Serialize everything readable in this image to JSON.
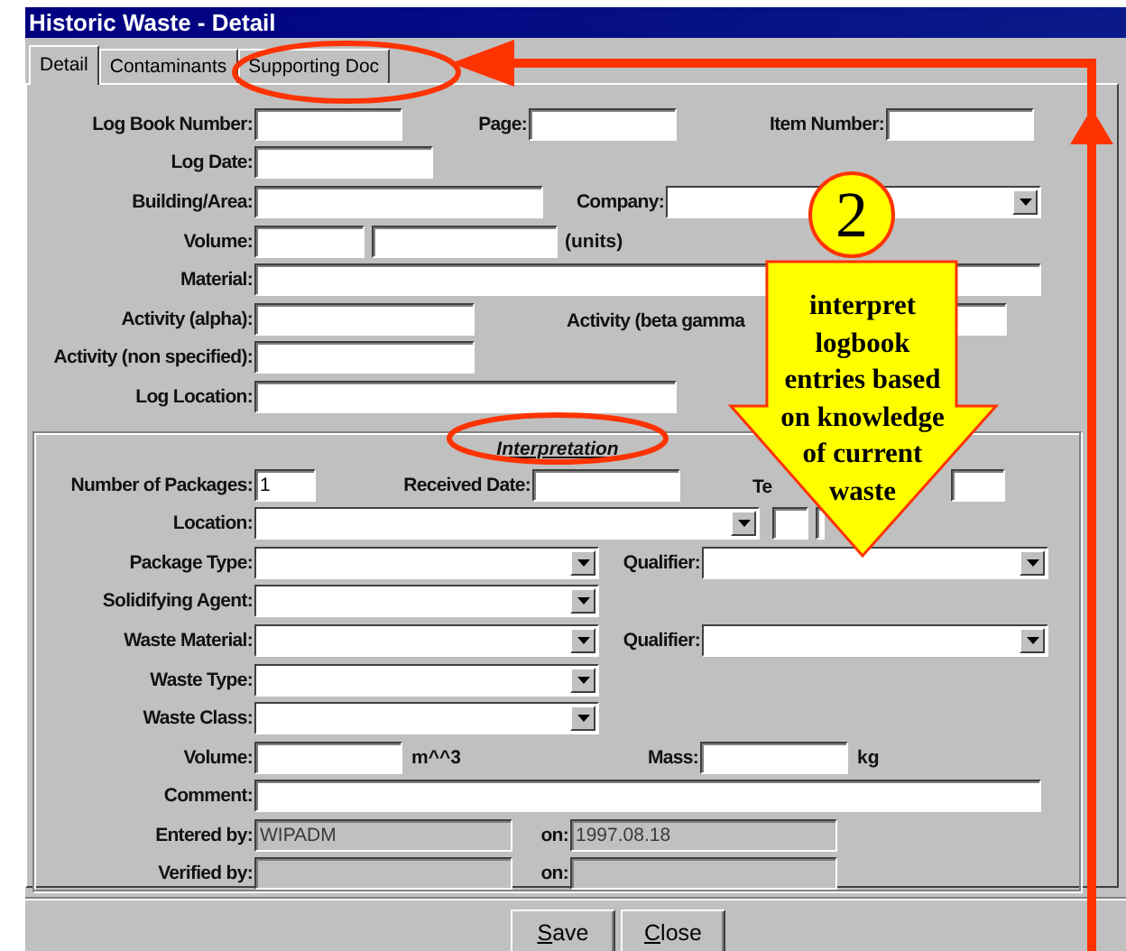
{
  "window": {
    "title": "Historic Waste - Detail"
  },
  "tabs": [
    {
      "label": "Detail",
      "selected": true
    },
    {
      "label": "Contaminants",
      "selected": false
    },
    {
      "label": "Supporting Doc",
      "selected": false
    }
  ],
  "fields": [
    [
      {
        "label": "Log Book Number:",
        "kind": "text"
      },
      {
        "label": "Page:",
        "kind": "text"
      },
      {
        "label": "Item Number:",
        "kind": "text"
      }
    ],
    [
      {
        "label": "Log Date:",
        "kind": "text"
      }
    ],
    [
      {
        "label": "Building/Area:",
        "kind": "text"
      },
      {
        "label": "Company:",
        "kind": "combo"
      }
    ],
    [
      {
        "label": "Volume:",
        "kind": "text"
      },
      {
        "kind": "text"
      },
      {
        "label": "(units)",
        "kind": "unit"
      }
    ],
    [
      {
        "label": "Material:",
        "kind": "text"
      }
    ],
    [
      {
        "label": "Activity (alpha):",
        "kind": "text"
      },
      {
        "label": "Activity (beta gamma",
        "kind": "text"
      }
    ],
    [
      {
        "label": "Activity (non specified):",
        "kind": "text"
      }
    ],
    [
      {
        "label": "Log Location:",
        "kind": "text"
      }
    ]
  ],
  "interpretation": {
    "heading": "Interpretation",
    "rows": [
      [
        {
          "label": "Number of Packages:",
          "kind": "text",
          "value": "1"
        },
        {
          "label": "Received Date:",
          "kind": "text"
        },
        {
          "label": "Te",
          "kind": "text"
        }
      ],
      [
        {
          "label": "Location:",
          "kind": "combo"
        },
        {
          "kind": "text"
        },
        {
          "kind": "text"
        }
      ],
      [
        {
          "label": "Package Type:",
          "kind": "combo"
        },
        {
          "label": "Qualifier:",
          "kind": "combo"
        }
      ],
      [
        {
          "label": "Solidifying Agent:",
          "kind": "combo"
        }
      ],
      [
        {
          "label": "Waste Material:",
          "kind": "combo"
        },
        {
          "label": "Qualifier:",
          "kind": "combo"
        }
      ],
      [
        {
          "label": "Waste Type:",
          "kind": "combo"
        }
      ],
      [
        {
          "label": "Waste Class:",
          "kind": "combo"
        }
      ],
      [
        {
          "label": "Volume:",
          "kind": "text"
        },
        {
          "label": "m^^3",
          "kind": "unit"
        },
        {
          "label": "Mass:",
          "kind": "text"
        },
        {
          "label": "kg",
          "kind": "unit"
        }
      ],
      [
        {
          "label": "Comment:",
          "kind": "text"
        }
      ],
      [
        {
          "label": "Entered by:",
          "kind": "readonly",
          "value": "WIPADM"
        },
        {
          "label": "on:",
          "kind": "readonly",
          "value": "1997.08.18"
        }
      ],
      [
        {
          "label": "Verified by:",
          "kind": "readonly"
        },
        {
          "label": "on:",
          "kind": "readonly"
        }
      ]
    ]
  },
  "buttons": [
    {
      "label": "Save",
      "underlined_first_letter": true
    },
    {
      "label": "Close",
      "underlined_first_letter": true
    }
  ],
  "callout": {
    "number": "2",
    "text": "interpret logbook entries based on knowledge of current waste"
  }
}
